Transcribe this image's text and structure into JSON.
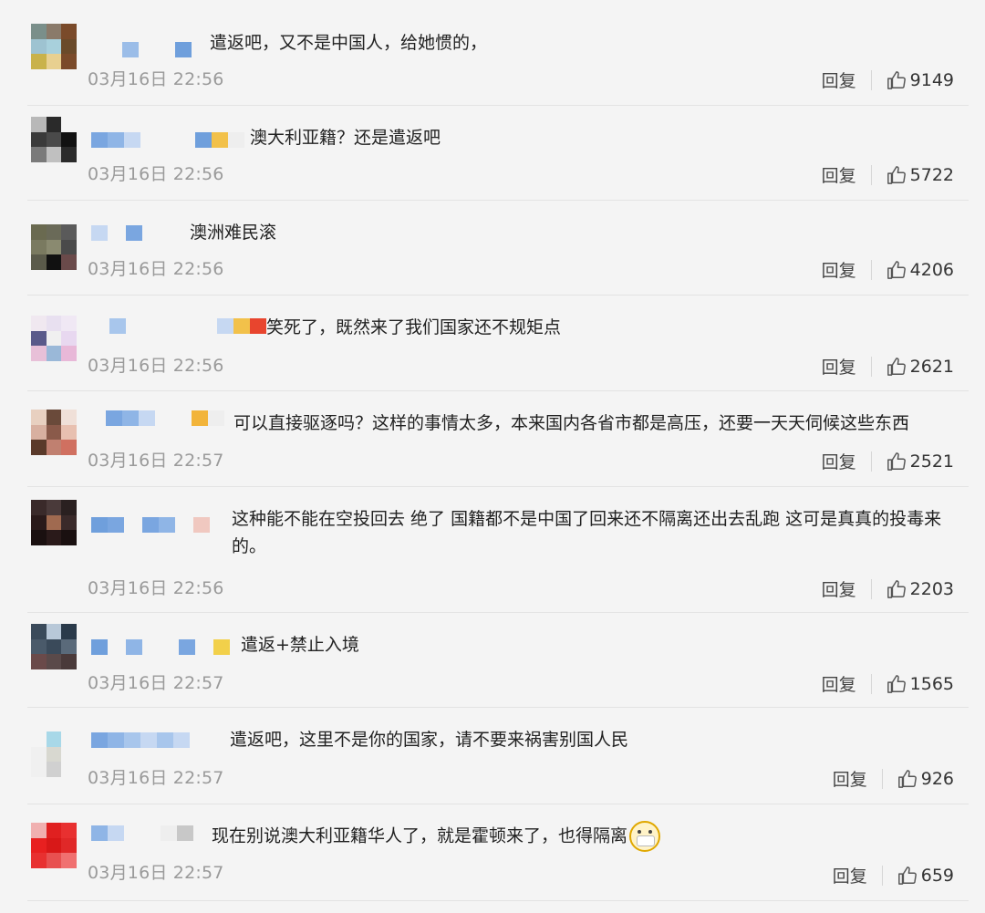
{
  "comments": [
    {
      "text": "遣返吧，又不是中国人，给她惯的，",
      "time": "03月16日 22:56",
      "reply": "回复",
      "likes": "9149"
    },
    {
      "text": "澳大利亚籍？还是遣返吧",
      "time": "03月16日 22:56",
      "reply": "回复",
      "likes": "5722"
    },
    {
      "text": "澳洲难民滚",
      "time": "03月16日 22:56",
      "reply": "回复",
      "likes": "4206"
    },
    {
      "text": "笑死了，既然来了我们国家还不规矩点",
      "time": "03月16日 22:56",
      "reply": "回复",
      "likes": "2621"
    },
    {
      "text": "可以直接驱逐吗？这样的事情太多，本来国内各省市都是高压，还要一天天伺候这些东西",
      "time": "03月16日 22:57",
      "reply": "回复",
      "likes": "2521"
    },
    {
      "text": "这种能不能在空投回去 绝了 国籍都不是中国了回来还不隔离还出去乱跑 这可是真真的投毒来的。",
      "time": "03月16日 22:56",
      "reply": "回复",
      "likes": "2203"
    },
    {
      "text": "遣返+禁止入境",
      "time": "03月16日 22:57",
      "reply": "回复",
      "likes": "1565"
    },
    {
      "text": "遣返吧，这里不是你的国家，请不要来祸害别国人民",
      "time": "03月16日 22:57",
      "reply": "回复",
      "likes": "926"
    },
    {
      "text": "现在别说澳大利亚籍华人了，就是霍顿来了，也得隔离",
      "time": "03月16日 22:57",
      "reply": "回复",
      "likes": "659"
    }
  ]
}
